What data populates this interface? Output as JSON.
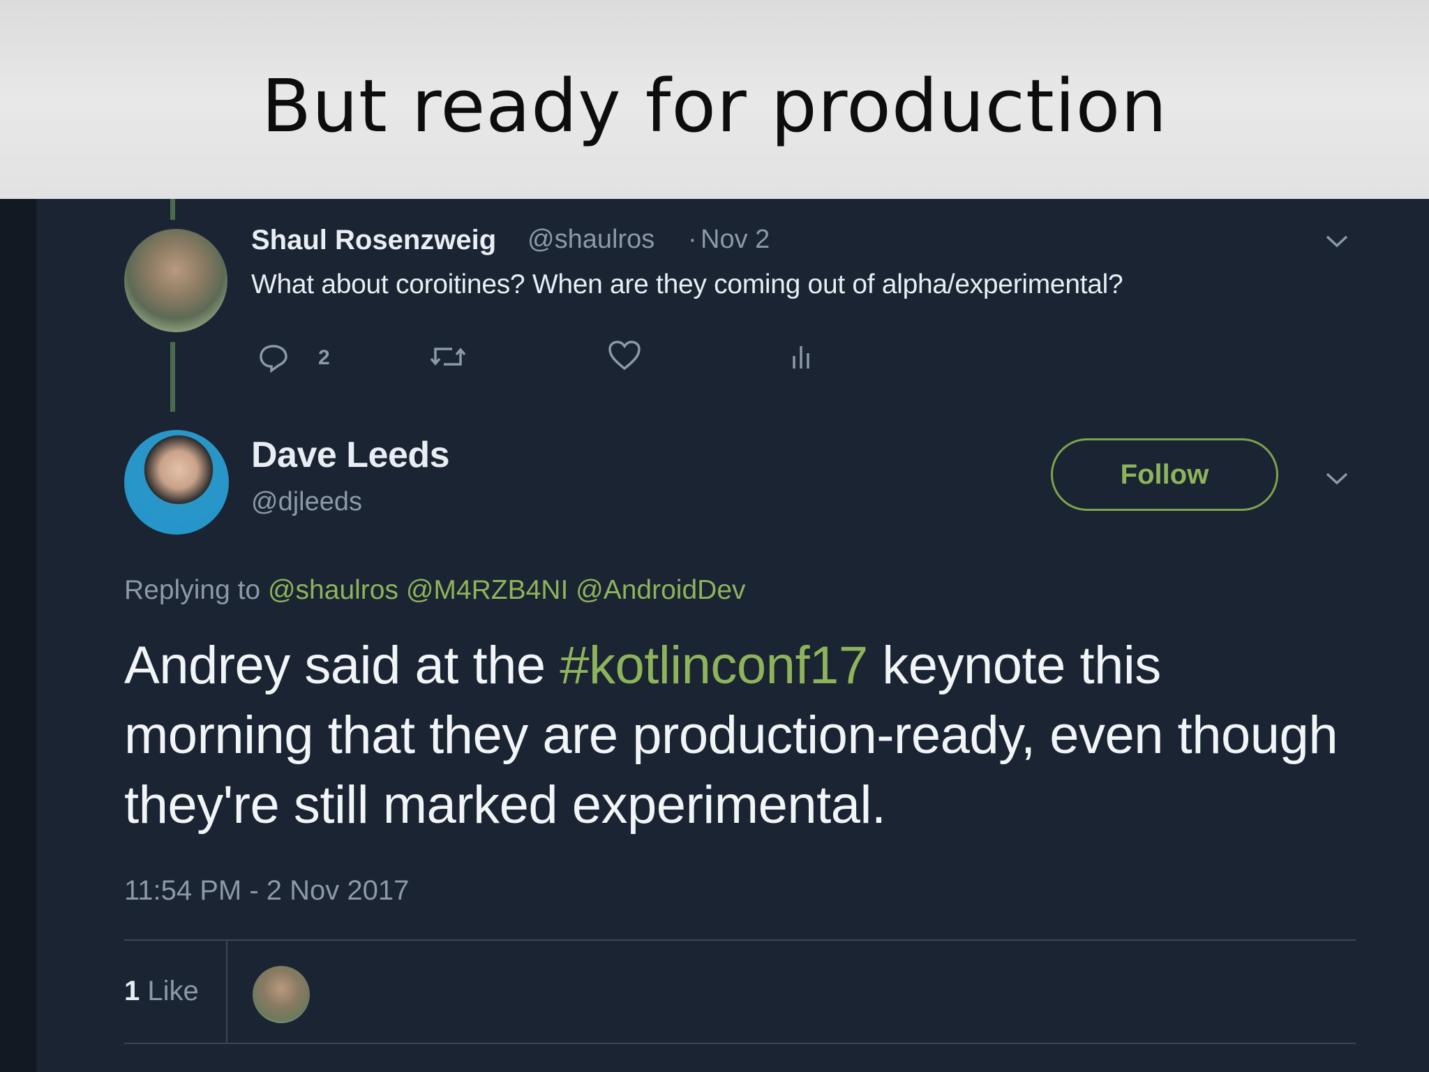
{
  "slide": {
    "title": "But ready for production"
  },
  "parent_tweet": {
    "author_name": "Shaul Rosenzweig",
    "author_handle": "@shaulros",
    "separator": "·",
    "date": "Nov 2",
    "text": "What about coroitines? When are they coming out of alpha/experimental?",
    "reply_count": "2",
    "icons": {
      "reply": "reply-icon",
      "retweet": "retweet-icon",
      "like": "heart-icon",
      "stats": "analytics-icon",
      "menu": "chevron-down-icon"
    }
  },
  "main_tweet": {
    "author_name": "Dave Leeds",
    "author_handle": "@djleeds",
    "follow_label": "Follow",
    "replying_prefix": "Replying to",
    "replying_mentions": [
      "@shaulros",
      "@M4RZB4NI",
      "@AndroidDev"
    ],
    "body_part1": "Andrey said at the ",
    "hashtag": "#kotlinconf17",
    "body_part2": " keynote this morning that they are production-ready, even though they're still marked experimental.",
    "timestamp": "11:54 PM - 2 Nov 2017",
    "likes_number": "1",
    "likes_label": "Like"
  },
  "colors": {
    "background": "#1a2433",
    "accent": "#8fb35a",
    "secondary_text": "#8d99a6",
    "primary_text": "#e8eef3"
  }
}
